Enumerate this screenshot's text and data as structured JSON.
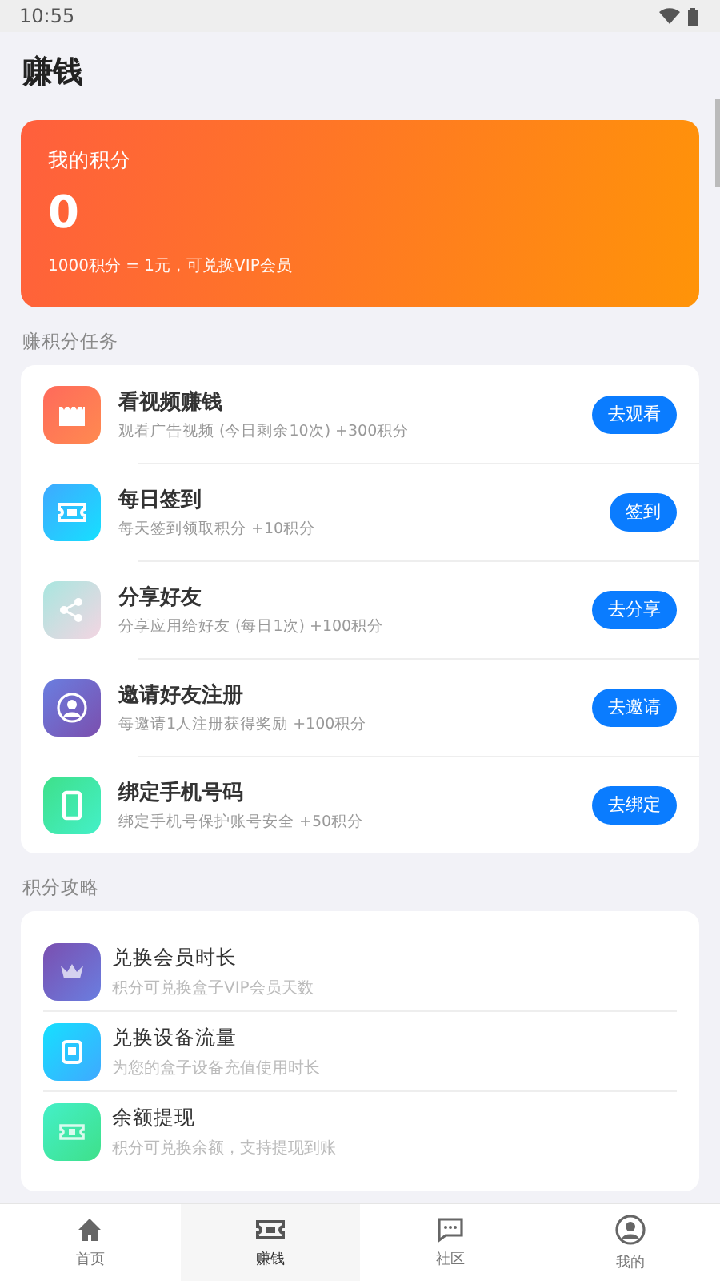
{
  "status_bar": {
    "time": "10:55"
  },
  "title": "赚钱",
  "points_card": {
    "label": "我的积分",
    "value": "0",
    "note": "1000积分 = 1元，可兑换VIP会员"
  },
  "tasks_section": {
    "heading": "赚积分任务",
    "items": [
      {
        "kind": "film",
        "title": "看视频赚钱",
        "desc": "观看广告视频 (今日剩余10次) +300积分",
        "button": "去观看"
      },
      {
        "kind": "ticket",
        "title": "每日签到",
        "desc": "每天签到领取积分 +10积分",
        "button": "签到"
      },
      {
        "kind": "share",
        "title": "分享好友",
        "desc": "分享应用给好友 (每日1次) +100积分",
        "button": "去分享"
      },
      {
        "kind": "person",
        "title": "邀请好友注册",
        "desc": "每邀请1人注册获得奖励 +100积分",
        "button": "去邀请"
      },
      {
        "kind": "phone",
        "title": "绑定手机号码",
        "desc": "绑定手机号保护账号安全 +50积分",
        "button": "去绑定"
      }
    ]
  },
  "guide_section": {
    "heading": "积分攻略",
    "items": [
      {
        "kind": "crown",
        "title": "兑换会员时长",
        "desc": "积分可兑换盒子VIP会员天数"
      },
      {
        "kind": "device",
        "title": "兑换设备流量",
        "desc": "为您的盒子设备充值使用时长"
      },
      {
        "kind": "cash",
        "title": "余额提现",
        "desc": "积分可兑换余额，支持提现到账"
      }
    ]
  },
  "tab_bar": [
    {
      "kind": "home",
      "label": "首页",
      "selected": false
    },
    {
      "kind": "ticket",
      "label": "赚钱",
      "selected": true
    },
    {
      "kind": "chat",
      "label": "社区",
      "selected": false
    },
    {
      "kind": "person",
      "label": "我的",
      "selected": false
    }
  ]
}
